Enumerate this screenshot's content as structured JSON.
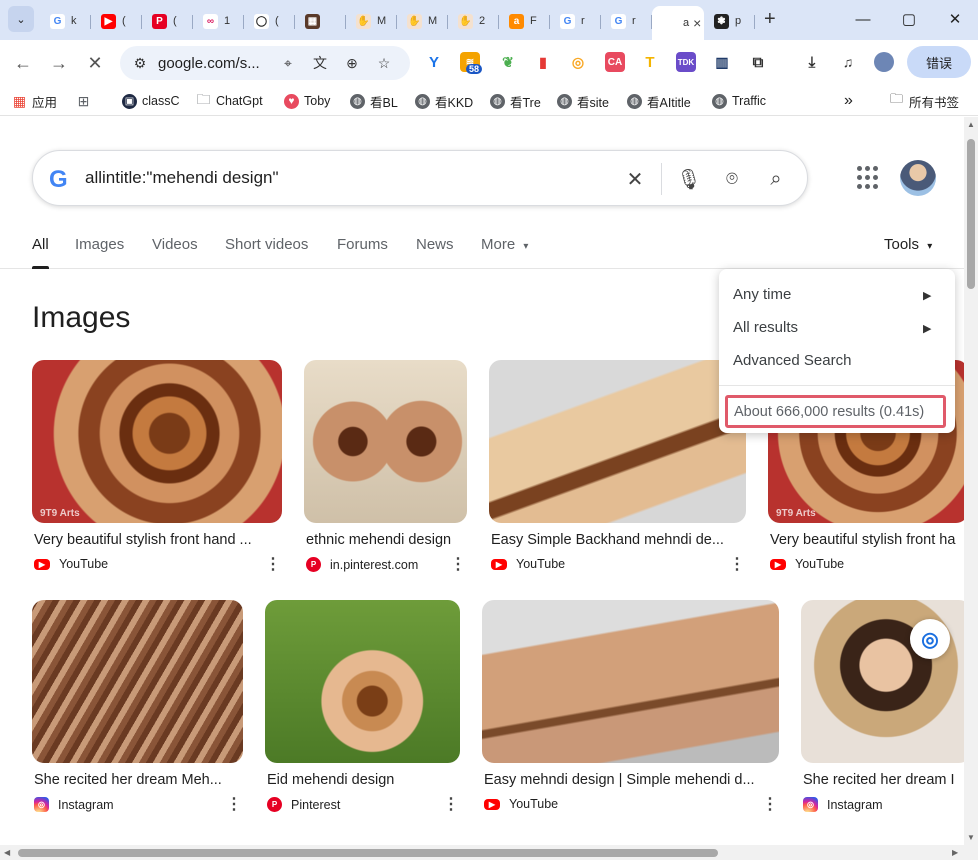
{
  "browser": {
    "tabs": [
      {
        "label": "k",
        "fav": "G",
        "color": "#ffffff",
        "fg": "#4285f4"
      },
      {
        "label": "(",
        "fav": "▶",
        "color": "#ff0000",
        "fg": "#ffffff"
      },
      {
        "label": "(",
        "fav": "P",
        "color": "#e60023",
        "fg": "#ffffff"
      },
      {
        "label": "1",
        "fav": "∞",
        "color": "#ffffff",
        "fg": "#d81b60"
      },
      {
        "label": "(",
        "fav": "◯",
        "color": "#ffffff",
        "fg": "#222222"
      },
      {
        "label": "",
        "fav": "▦",
        "color": "#5a3a2a",
        "fg": "#ffffff"
      },
      {
        "label": "M",
        "fav": "✋",
        "color": "#f4e1cf",
        "fg": "#8a4a20"
      },
      {
        "label": "M",
        "fav": "✋",
        "color": "#f4e1cf",
        "fg": "#8a4a20"
      },
      {
        "label": "2",
        "fav": "✋",
        "color": "#f4e1cf",
        "fg": "#8a4a20"
      },
      {
        "label": "F",
        "fav": "a",
        "color": "#ff8a00",
        "fg": "#ffffff"
      },
      {
        "label": "r",
        "fav": "G",
        "color": "#ffffff",
        "fg": "#4285f4"
      },
      {
        "label": "r",
        "fav": "G",
        "color": "#ffffff",
        "fg": "#4285f4"
      },
      {
        "label": "a",
        "fav": "",
        "color": "#ffffff",
        "fg": "#222222",
        "active": true
      },
      {
        "label": "p",
        "fav": "❃",
        "color": "#222222",
        "fg": "#ffffff"
      }
    ],
    "tab_close": "×",
    "new_tab": "+",
    "window": {
      "minimize": "—",
      "maximize": "▢",
      "close": "✕"
    },
    "toolbar": {
      "back": "←",
      "forward": "→",
      "stop": "✕",
      "url": "google.com/s...",
      "ext_badge": "58",
      "profile_button": "错误"
    },
    "bookmarks": [
      {
        "label": "应用",
        "icon": "apps-grid",
        "color": "#ea4335"
      },
      {
        "label": "",
        "icon": "tab-groups",
        "color": "#5f6368"
      },
      {
        "label": "classC",
        "icon": "terminal",
        "color": "#1f2a44"
      },
      {
        "label": "ChatGpt",
        "icon": "folder",
        "color": "#5f6368"
      },
      {
        "label": "Toby",
        "icon": "toby",
        "color": "#e84a5f"
      },
      {
        "label": "看BL",
        "icon": "globe",
        "color": "#5f6368"
      },
      {
        "label": "看KKD",
        "icon": "globe",
        "color": "#5f6368"
      },
      {
        "label": "看Tre",
        "icon": "globe",
        "color": "#5f6368"
      },
      {
        "label": "看site",
        "icon": "globe",
        "color": "#5f6368"
      },
      {
        "label": "看AItitle",
        "icon": "globe",
        "color": "#5f6368"
      },
      {
        "label": "Traffic",
        "icon": "globe",
        "color": "#5f6368"
      }
    ],
    "bookmarks_more": "»",
    "all_bookmarks": "所有书签"
  },
  "search": {
    "query": "allintitle:\"mehendi design\"",
    "logo": "G"
  },
  "nav": {
    "tabs": [
      "All",
      "Images",
      "Videos",
      "Short videos",
      "Forums",
      "News",
      "More"
    ],
    "tools": "Tools"
  },
  "images_section": {
    "title": "Images",
    "row1": [
      {
        "title": "Very beautiful stylish front hand ...",
        "source": "YouTube",
        "src_type": "yt"
      },
      {
        "title": "ethnic mehendi design",
        "source": "in.pinterest.com",
        "src_type": "pin"
      },
      {
        "title": "Easy Simple Backhand mehndi de...",
        "source": "YouTube",
        "src_type": "yt"
      },
      {
        "title": "Very beautiful stylish front ha",
        "source": "YouTube",
        "src_type": "yt"
      }
    ],
    "row2": [
      {
        "title": "She recited her dream Meh...",
        "source": "Instagram",
        "src_type": "ig"
      },
      {
        "title": "Eid mehendi design",
        "source": "Pinterest",
        "src_type": "pin"
      },
      {
        "title": "Easy mehndi design | Simple mehendi d...",
        "source": "YouTube",
        "src_type": "yt"
      },
      {
        "title": "She recited her dream I",
        "source": "Instagram",
        "src_type": "ig"
      }
    ],
    "thumb_watermark": "9T9 Arts"
  },
  "tools_menu": {
    "items": [
      "Any time",
      "All results",
      "Advanced Search"
    ],
    "result_stats": "About 666,000 results (0.41s)"
  },
  "colors": {
    "accent_highlight": "#e05a6a",
    "tabstrip": "#dbe5f7"
  }
}
